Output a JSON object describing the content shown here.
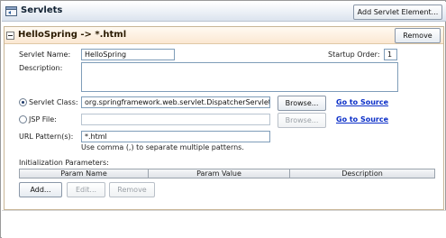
{
  "header": {
    "title": "Servlets",
    "add_button": "Add Servlet Element..."
  },
  "panel": {
    "title": "HelloSpring -> *.html",
    "remove_button": "Remove",
    "servlet_name_label": "Servlet Name:",
    "servlet_name_value": "HelloSpring",
    "startup_order_label": "Startup Order:",
    "startup_order_value": "1",
    "description_label": "Description:",
    "servlet_class_label": "Servlet Class:",
    "servlet_class_value": "org.springframework.web.servlet.DispatcherServlet",
    "browse_label": "Browse...",
    "go_to_source": "Go to Source",
    "jsp_file_label": "JSP File:",
    "jsp_file_value": "",
    "url_pattern_label": "URL Pattern(s):",
    "url_pattern_value": "*.html",
    "url_hint": "Use comma (,) to separate multiple patterns.",
    "init_params_label": "Initialization Parameters:",
    "columns": [
      "Param Name",
      "Param Value",
      "Description"
    ],
    "add_button": "Add...",
    "edit_button": "Edit...",
    "remove_param_button": "Remove"
  }
}
